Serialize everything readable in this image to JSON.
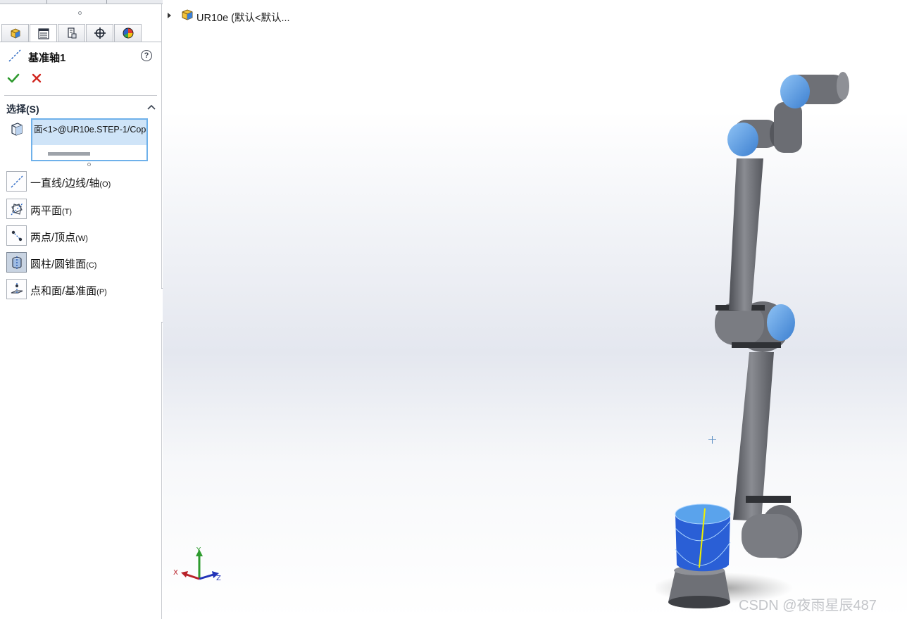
{
  "property_manager": {
    "tabs": [
      {
        "name": "featuremanager-tab",
        "icon": "feature-tree-icon"
      },
      {
        "name": "propertymanager-tab",
        "icon": "property-manager-icon",
        "active": true
      },
      {
        "name": "configurationmanager-tab",
        "icon": "configuration-icon"
      },
      {
        "name": "dimxpert-tab",
        "icon": "crosshair-icon"
      },
      {
        "name": "displaymanager-tab",
        "icon": "appearance-pie-icon"
      }
    ],
    "title": "基准轴1",
    "title_icon": "axis-icon",
    "help": "?",
    "ok_icon": "green-check-icon",
    "cancel_icon": "red-x-icon",
    "selection_section": {
      "label": "选择(S)",
      "selected_item": "面<1>@UR10e.STEP-1/Cop"
    },
    "options": [
      {
        "label": "一直线/边线/轴",
        "key": "(O)",
        "icon": "line-edge-axis-icon",
        "pressed": false
      },
      {
        "label": "两平面",
        "key": "(T)",
        "icon": "two-planes-icon",
        "pressed": false
      },
      {
        "label": "两点/顶点",
        "key": "(W)",
        "icon": "two-points-icon",
        "pressed": false
      },
      {
        "label": "圆柱/圆锥面",
        "key": "(C)",
        "icon": "cylinder-cone-icon",
        "pressed": true
      },
      {
        "label": "点和面/基准面",
        "key": "(P)",
        "icon": "point-plane-icon",
        "pressed": false
      }
    ]
  },
  "graphics": {
    "tree_item": "UR10e  (默认<默认...",
    "triad": {
      "x": "X",
      "y": "Y",
      "z": "Z"
    },
    "watermark": "CSDN @夜雨星辰487",
    "colors": {
      "robot_cap": "#4a90d8",
      "robot_body": "#6e7076",
      "selection_highlight": "#2a5fd6"
    }
  }
}
